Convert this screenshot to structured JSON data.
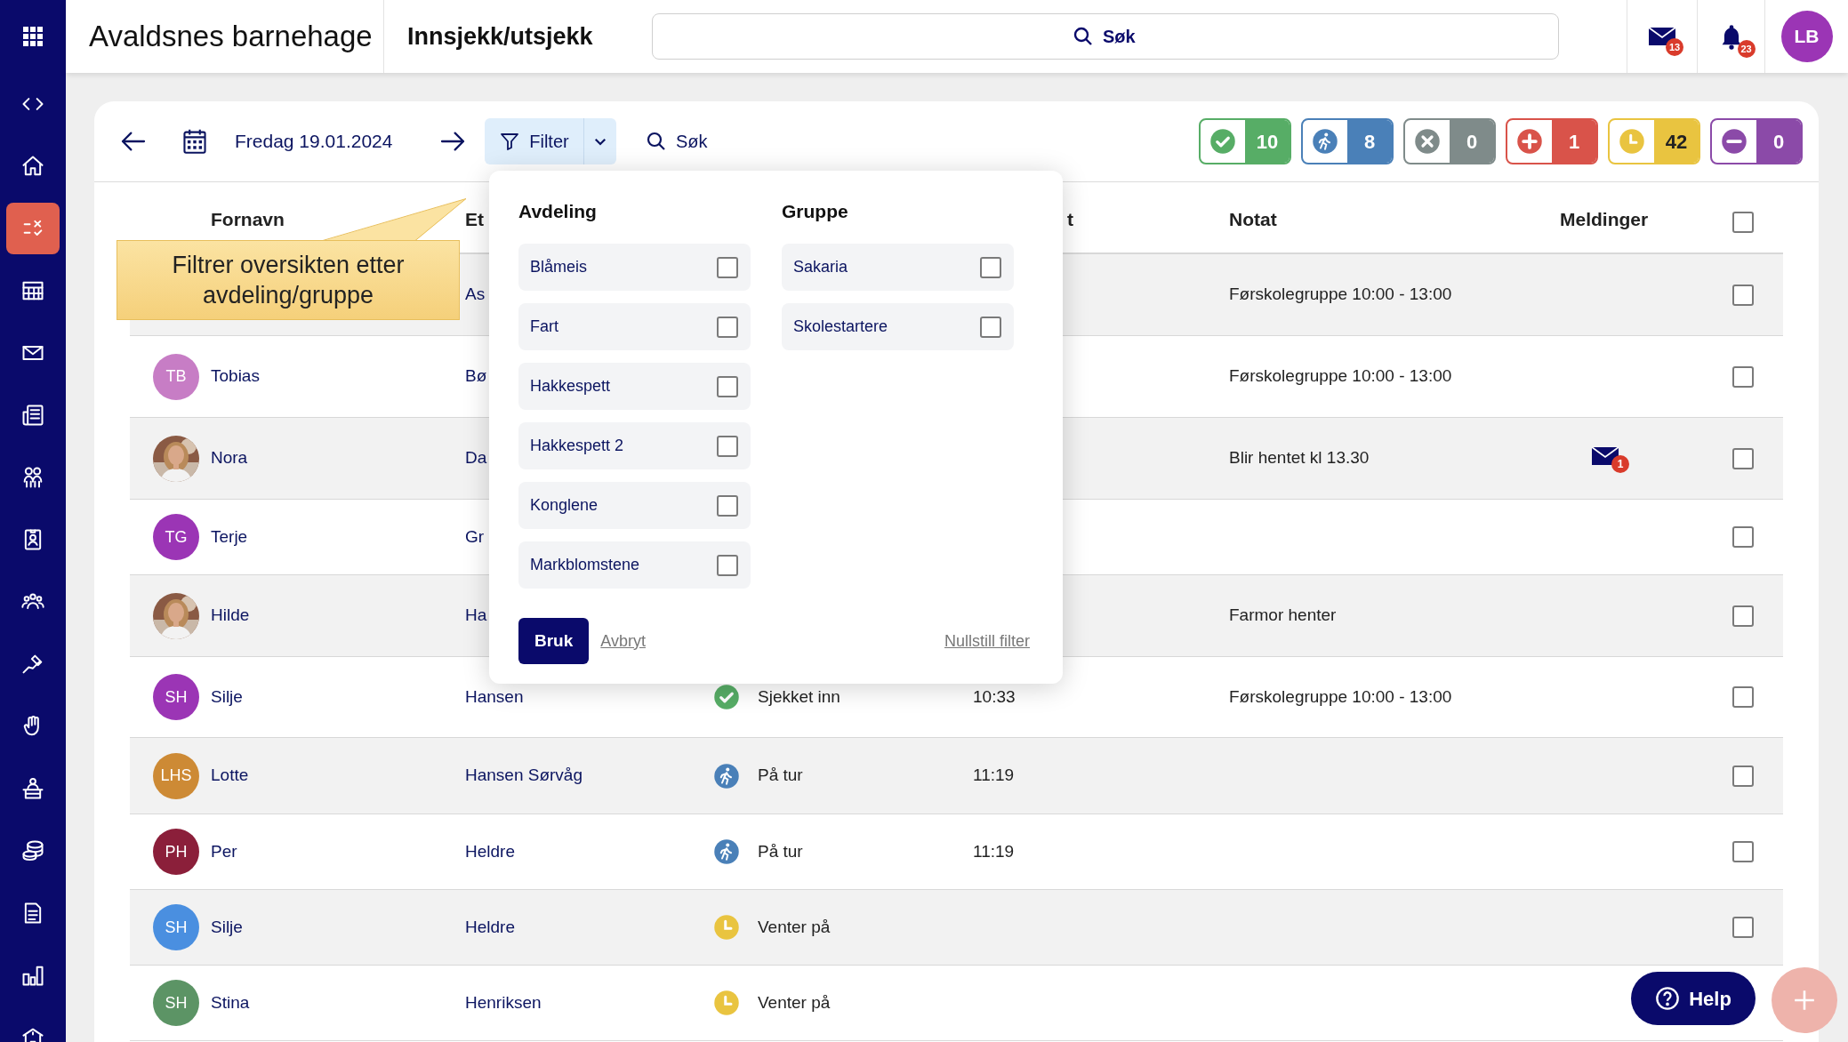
{
  "header": {
    "title": "Avaldsnes barnehage",
    "page": "Innsjekk/utsjekk",
    "search": {
      "placeholder": "Søk"
    },
    "mail_count": "13",
    "notification_count": "23",
    "avatar": "LB"
  },
  "sidebar": {
    "items": [
      {
        "selected": false
      },
      {
        "selected": false
      },
      {
        "selected": true
      },
      {
        "selected": false
      },
      {
        "selected": false
      },
      {
        "selected": false
      },
      {
        "selected": false
      },
      {
        "selected": false
      },
      {
        "selected": false
      },
      {
        "selected": false
      },
      {
        "selected": false
      },
      {
        "selected": false
      },
      {
        "selected": false
      },
      {
        "selected": false
      },
      {
        "selected": false
      },
      {
        "selected": false
      }
    ]
  },
  "toolbar": {
    "date": "Fredag 19.01.2024",
    "filter": "Filter",
    "search": "Søk"
  },
  "status_counts": [
    {
      "kind": "checked_in",
      "count": "10",
      "color": "#57ad66"
    },
    {
      "kind": "on_trip",
      "count": "8",
      "color": "#4a80b8"
    },
    {
      "kind": "absent",
      "count": "0",
      "color": "#7f8b8a"
    },
    {
      "kind": "sick",
      "count": "1",
      "color": "#d9534a"
    },
    {
      "kind": "waiting",
      "count": "42",
      "color": "#e9c440"
    },
    {
      "kind": "off",
      "count": "0",
      "color": "#8b4aa8"
    }
  ],
  "tooltip": "Filtrer oversikten etter avdeling/gruppe",
  "filter_panel": {
    "sections": [
      {
        "title": "Avdeling",
        "options": [
          {
            "label": "Blåmeis",
            "checked": false
          },
          {
            "label": "Fart",
            "checked": false
          },
          {
            "label": "Hakkespett",
            "checked": false
          },
          {
            "label": "Hakkespett 2",
            "checked": false
          },
          {
            "label": "Konglene",
            "checked": false
          },
          {
            "label": "Markblomstene",
            "checked": false
          }
        ]
      },
      {
        "title": "Gruppe",
        "options": [
          {
            "label": "Sakaria",
            "checked": false
          },
          {
            "label": "Skolestartere",
            "checked": false
          }
        ]
      }
    ],
    "apply": "Bruk",
    "cancel": "Avbryt",
    "reset": "Nullstill filter"
  },
  "table": {
    "columns": [
      {
        "label": "Fornavn"
      },
      {
        "label": "Et"
      },
      {
        "label": "t"
      },
      {
        "label": "Notat"
      },
      {
        "label": "Meldinger"
      }
    ],
    "select_all_checked": false,
    "rows": [
      {
        "last_name": "As",
        "note": "Førskolegruppe 10:00 - 13:00",
        "checked": false
      },
      {
        "avatar": {
          "kind": "initials",
          "initials": "TB",
          "color": "#c77dc5"
        },
        "first_name": "Tobias",
        "last_name": "Bø",
        "note": "Førskolegruppe 10:00 - 13:00",
        "checked": false
      },
      {
        "first_name": "Nora",
        "last_name": "Da",
        "note": "Blir hentet kl 13.30",
        "messages": "1",
        "checked": false
      },
      {
        "avatar": {
          "kind": "initials",
          "initials": "TG",
          "color": "#9b35b5"
        },
        "first_name": "Terje",
        "last_name": "Gr",
        "checked": false
      },
      {
        "first_name": "Hilde",
        "last_name": "Ha",
        "note": "Farmor henter",
        "checked": false
      },
      {
        "avatar": {
          "kind": "initials",
          "initials": "SH",
          "color": "#9b35b5"
        },
        "first_name": "Silje",
        "last_name": "Hansen",
        "status": {
          "kind": "checked_in",
          "label": "Sjekket inn"
        },
        "time": "10:33",
        "note": "Førskolegruppe 10:00 - 13:00",
        "checked": false
      },
      {
        "avatar": {
          "kind": "initials",
          "initials": "LHS",
          "color": "#cd8a35"
        },
        "first_name": "Lotte",
        "last_name": "Hansen Sørvåg",
        "status": {
          "kind": "on_trip",
          "label": "På tur"
        },
        "time": "11:19",
        "checked": false
      },
      {
        "avatar": {
          "kind": "initials",
          "initials": "PH",
          "color": "#8b1f3a"
        },
        "first_name": "Per",
        "last_name": "Heldre",
        "status": {
          "kind": "on_trip",
          "label": "På tur"
        },
        "time": "11:19",
        "checked": false
      },
      {
        "avatar": {
          "kind": "initials",
          "initials": "SH",
          "color": "#4a8fe0"
        },
        "first_name": "Silje",
        "last_name": "Heldre",
        "status": {
          "kind": "waiting",
          "label": "Venter på"
        },
        "checked": false
      },
      {
        "avatar": {
          "kind": "initials",
          "initials": "SH",
          "color": "#5c9465"
        },
        "first_name": "Stina",
        "last_name": "Henriksen",
        "status": {
          "kind": "waiting",
          "label": "Venter på"
        }
      }
    ]
  },
  "help": "Help"
}
